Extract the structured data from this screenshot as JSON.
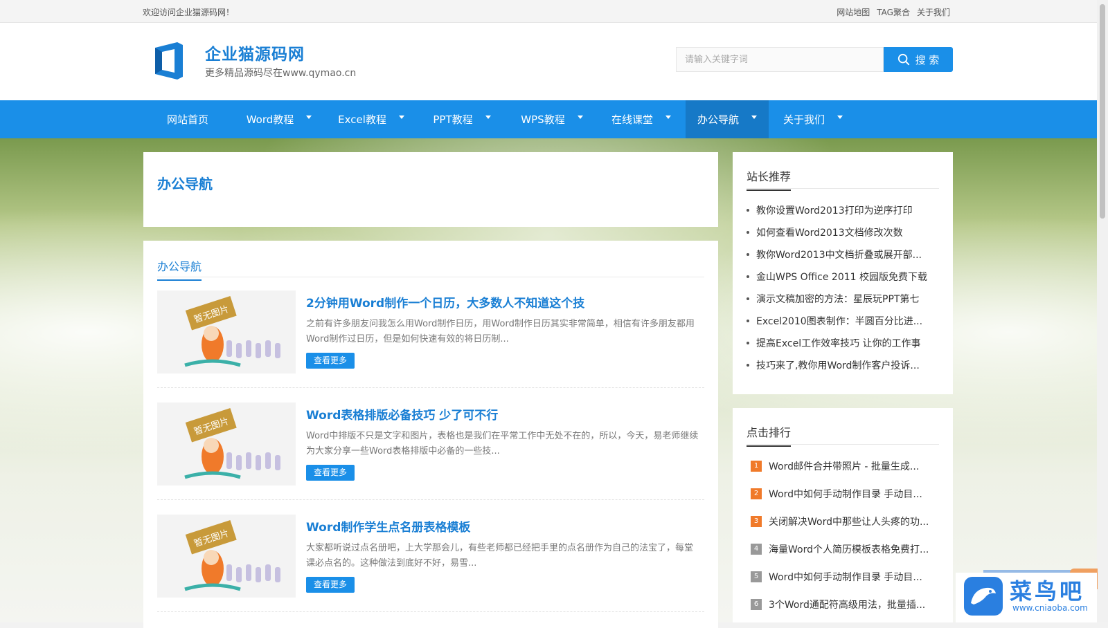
{
  "topbar": {
    "welcome": "欢迎访问企业猫源码网！",
    "links": [
      "网站地图",
      "TAG聚合",
      "关于我们"
    ]
  },
  "header": {
    "site_name": "企业猫源码网",
    "tagline": "更多精品源码尽在www.qymao.cn",
    "search_placeholder": "请输入关键字词",
    "search_button": "搜 索"
  },
  "nav": {
    "items": [
      {
        "label": "网站首页",
        "has_caret": false
      },
      {
        "label": "Word教程",
        "has_caret": true
      },
      {
        "label": "Excel教程",
        "has_caret": true
      },
      {
        "label": "PPT教程",
        "has_caret": true
      },
      {
        "label": "WPS教程",
        "has_caret": true
      },
      {
        "label": "在线课堂",
        "has_caret": true
      },
      {
        "label": "办公导航",
        "has_caret": true,
        "active": true
      },
      {
        "label": "关于我们",
        "has_caret": true
      }
    ]
  },
  "page": {
    "title": "办公导航",
    "list_tab": "办公导航",
    "thumb_text": "暂无图片",
    "articles": [
      {
        "title": "2分钟用Word制作一个日历，大多数人不知道这个技",
        "desc": "之前有许多朋友问我怎么用Word制作日历，用Word制作日历其实非常简单，相信有许多朋友都用Word制作过日历，但是如何快速有效的将日历制...",
        "more": "查看更多"
      },
      {
        "title": "Word表格排版必备技巧 少了可不行",
        "desc": "Word中排版不只是文字和图片，表格也是我们在平常工作中无处不在的，所以，今天，易老师继续为大家分享一些Word表格排版中必备的一些技...",
        "more": "查看更多"
      },
      {
        "title": "Word制作学生点名册表格模板",
        "desc": "大家都听说过点名册吧，上大学那会儿，有些老师都已经把手里的点名册作为自己的法宝了，每堂课必点名的。这种做法到底好不好，易雪...",
        "more": "查看更多"
      }
    ]
  },
  "sidebar": {
    "recommend_title": "站长推荐",
    "recommend": [
      "教你设置Word2013打印为逆序打印",
      "如何查看Word2013文档修改次数",
      "教你Word2013中文档折叠或展开部...",
      "金山WPS Office 2011 校园版免费下载",
      "演示文稿加密的方法：星辰玩PPT第七",
      "Excel2010图表制作：半圆百分比进...",
      "提高Excel工作效率技巧 让你的工作事",
      "技巧来了,教你用Word制作客户投诉..."
    ],
    "rank_title": "点击排行",
    "rank": [
      {
        "num": "1",
        "text": "Word邮件合并带照片 - 批量生成...",
        "color": "#f07a2a"
      },
      {
        "num": "2",
        "text": "Word中如何手动制作目录 手动目...",
        "color": "#f07a2a"
      },
      {
        "num": "3",
        "text": "关闭解决Word中那些让人头疼的功...",
        "color": "#f07a2a"
      },
      {
        "num": "4",
        "text": "海量Word个人简历模板表格免费打...",
        "color": "#999999"
      },
      {
        "num": "5",
        "text": "Word中如何手动制作目录 手动目...",
        "color": "#999999"
      },
      {
        "num": "6",
        "text": "3个Word通配符高级用法，批量插...",
        "color": "#999999"
      }
    ]
  },
  "watermark": {
    "title": "菜鸟吧",
    "url": "www.cniaoba.com"
  },
  "colors": {
    "brand_blue": "#1a8fe8",
    "title_blue": "#1a7fd4",
    "nav_active": "#1679c7",
    "rank_hot": "#f07a2a",
    "rank_normal": "#999999"
  }
}
